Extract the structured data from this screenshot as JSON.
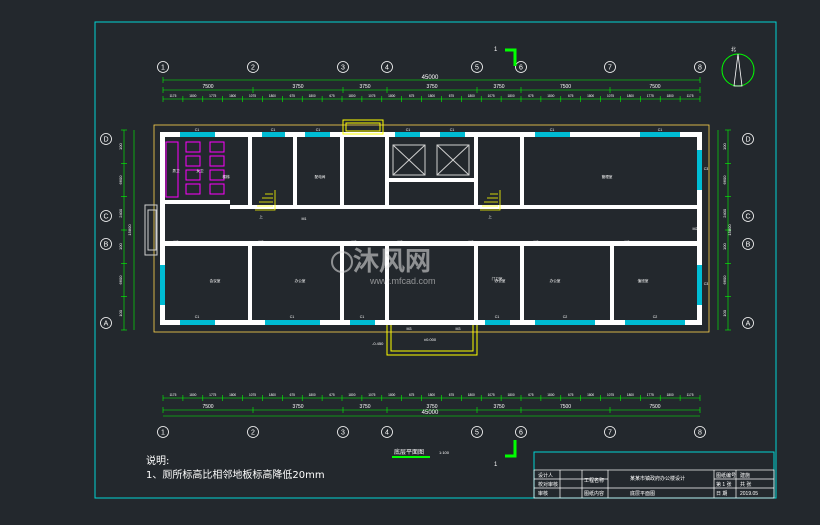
{
  "drawing": {
    "title": "底层平面图",
    "scale": "1:100",
    "section_mark": "1",
    "north_label": "北",
    "axes_horizontal": [
      "1",
      "2",
      "3",
      "4",
      "5",
      "6",
      "7",
      "8"
    ],
    "axes_vertical": [
      "D",
      "C",
      "B",
      "A"
    ],
    "overall_length": "45000",
    "top_dims_level2": [
      "7500",
      "3750",
      "3750",
      "3750",
      "3750",
      "7500",
      "7500"
    ],
    "top_dims_level1": [
      "1175",
      "1800",
      "1775",
      "1800",
      "1075",
      "1800",
      "675",
      "1800",
      "675",
      "1800",
      "1075",
      "1800",
      "675",
      "1800",
      "675",
      "1800",
      "1075",
      "1800",
      "675",
      "1800",
      "675",
      "1800",
      "1075",
      "1800",
      "1775",
      "1800",
      "1175"
    ],
    "bottom_dims_level2": [
      "7500",
      "3750",
      "3750",
      "3750",
      "3750",
      "7500",
      "7500"
    ],
    "left_dims": [
      "100",
      "6600",
      "2400",
      "100",
      "6600",
      "100"
    ],
    "left_total": "15800",
    "right_dims": [
      "100",
      "6600",
      "2400",
      "100",
      "6600",
      "100"
    ],
    "right_total": "15800",
    "elevation_main": "±0.000",
    "elevation_entrance": "-0.450",
    "room_labels": [
      "男卫",
      "女卫",
      "楼梯",
      "配电间",
      "上",
      "管理室",
      "会议室",
      "办公室",
      "办公室",
      "办公室",
      "值班室",
      "门卫室",
      "上"
    ],
    "door_labels": [
      "M1",
      "M2",
      "M2",
      "M2",
      "M2",
      "M2",
      "M2",
      "M2",
      "M2",
      "M3",
      "M3"
    ],
    "window_labels": [
      "C1",
      "C1",
      "C1",
      "C1",
      "C1",
      "C1",
      "C1",
      "C1",
      "C1",
      "C1",
      "C1",
      "C2",
      "C2",
      "C3",
      "C3"
    ]
  },
  "notes": {
    "title": "说明:",
    "items": [
      "1、厕所标高比相邻地板标高降低20mm"
    ]
  },
  "title_block": {
    "designer_label": "设计人",
    "checker_label": "校对审核",
    "approver_label": "审核",
    "project_label": "工程名称",
    "project_name": "某某市镇政府办公楼设计",
    "drawing_label": "图纸内容",
    "drawing_name": "底层平面图",
    "drawing_no_label": "图纸编号",
    "drawing_no_value": "建施",
    "sheet_label": "第 1 张",
    "total_label": "共 张",
    "date_label": "日 期",
    "date_value": "2019.05"
  },
  "watermark": {
    "brand": "沐风网",
    "url": "www.mfcad.com"
  },
  "colors": {
    "background": "#23282d",
    "frame": "#00d4d4",
    "dimension": "#00ff00",
    "wall": "#ffffff",
    "window": "#00bcd4",
    "fixture": "#ff00ff",
    "stair": "#ffff00",
    "entrance": "#ffff00"
  }
}
